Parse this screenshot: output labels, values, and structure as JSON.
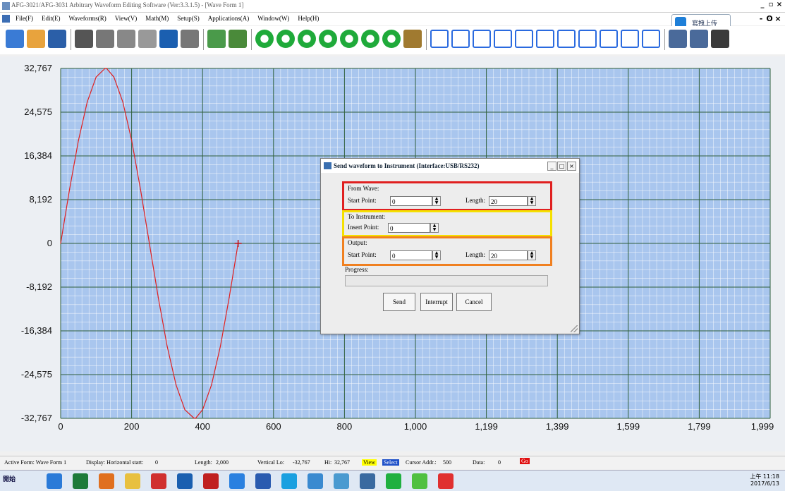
{
  "window": {
    "title": "AFG-3021/AFG-3031 Arbitrary Waveform Editing Software (Ver:3.3.1.5) - [Wave Form 1]"
  },
  "menu": [
    "File(F)",
    "Edit(E)",
    "Waveforms(R)",
    "View(V)",
    "Math(M)",
    "Setup(S)",
    "Applications(A)",
    "Window(W)",
    "Help(H)"
  ],
  "upload_button": {
    "label": "寫拽上传"
  },
  "toolbar": {
    "icons": [
      "new-file-icon",
      "open-folder-icon",
      "save-icon",
      "print-icon",
      "cut-icon",
      "copy-icon",
      "paste-icon",
      "undo-icon",
      "redo-icon",
      "wave-view-icon",
      "image-icon",
      "zoom-in-icon",
      "zoom-out-icon",
      "zoom-auto-icon",
      "scroll-left-icon",
      "scroll-right-icon",
      "scroll-up-icon",
      "scroll-down-icon",
      "hand-pan-icon",
      "line-tool-icon",
      "sine-tool-icon",
      "square-wave-icon",
      "pulse-wave-icon",
      "sine-wave-icon",
      "triangle-wave-icon",
      "ramp-wave-icon",
      "exp-rise-icon",
      "exp-fall-icon",
      "noise-wave-icon",
      "dc-wave-icon",
      "instrument-icon",
      "settings-panel-icon",
      "tools-icon"
    ]
  },
  "chart_data": {
    "type": "line",
    "title": "",
    "xlabel": "",
    "ylabel": "",
    "xlim": [
      0,
      1999
    ],
    "ylim": [
      -32767,
      32767
    ],
    "x_ticks": [
      "0",
      "200",
      "400",
      "600",
      "800",
      "1,000",
      "1,199",
      "1,399",
      "1,599",
      "1,799",
      "1,999"
    ],
    "y_ticks": [
      "32,767",
      "24,575",
      "16,384",
      "8,192",
      "0",
      "-8,192",
      "-16,384",
      "-24,575",
      "-32,767"
    ],
    "grid": true,
    "series": [
      {
        "color": "#e02020",
        "x": [
          0,
          25,
          50,
          75,
          100,
          125,
          130,
          150,
          175,
          200,
          225,
          250,
          275,
          300,
          325,
          350,
          375,
          380,
          400,
          425,
          450,
          475,
          500
        ],
        "y": [
          0,
          10125,
          19260,
          26510,
          31160,
          32767,
          32720,
          31160,
          26510,
          19260,
          10125,
          0,
          -10125,
          -19260,
          -26510,
          -31160,
          -32700,
          -32767,
          -31160,
          -26510,
          -19260,
          -10125,
          0
        ]
      }
    ],
    "cursor": {
      "x": 500,
      "y": 0,
      "color": "#c01010"
    }
  },
  "dialog": {
    "title": "Send waveform to Instrument (Interface:USB/RS232)",
    "from_wave": {
      "label": "From Wave:",
      "start_label": "Start Point:",
      "start_value": "0",
      "length_label": "Length:",
      "length_value": "20",
      "border_color": "#e02020"
    },
    "to_instrument": {
      "label": "To Instrument:",
      "insert_label": "Insert Point:",
      "insert_value": "0",
      "border_color": "#f5e000"
    },
    "output": {
      "label": "Output:",
      "start_label": "Start Point:",
      "start_value": "0",
      "length_label": "Length:",
      "length_value": "20",
      "border_color": "#f08020"
    },
    "progress_label": "Progress:",
    "buttons": {
      "send": "Send",
      "interrupt": "Interrupt",
      "cancel": "Cancel"
    }
  },
  "status": {
    "active_form": "Active Form:  Wave Form 1",
    "display": "Display:  Horizontal start:",
    "h_start": "0",
    "length_label": "Length:",
    "length": "2,000",
    "vlo_label": "Vertical Lo:",
    "vlo": "-32,767",
    "hi_label": "Hi:",
    "hi": "32,767",
    "view": "View",
    "select": "Select",
    "cursor_label": "Cursor Addr.:",
    "cursor": "500",
    "data_label": "Data:",
    "data": "0",
    "go": "Go"
  },
  "taskbar": {
    "start": "開始",
    "clock_time": "上午 11:18",
    "clock_date": "2017/6/13"
  }
}
